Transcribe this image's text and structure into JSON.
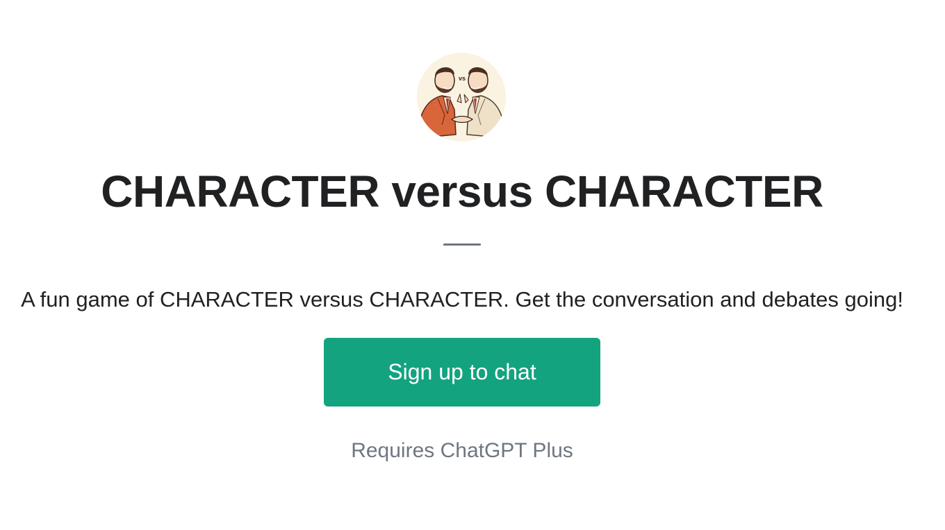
{
  "gpt": {
    "avatar_alt": "Two men debating illustration",
    "title": "CHARACTER versus CHARACTER",
    "description": "A fun game of CHARACTER versus CHARACTER. Get the conversation and debates going!",
    "signup_label": "Sign up to chat",
    "requirement": "Requires ChatGPT Plus"
  },
  "colors": {
    "background": "#ffffff",
    "title_text": "#202123",
    "muted_text": "#6e7681",
    "button_bg": "#13a37f",
    "button_text": "#ffffff"
  },
  "icons": {
    "avatar": "debate-illustration-icon"
  }
}
